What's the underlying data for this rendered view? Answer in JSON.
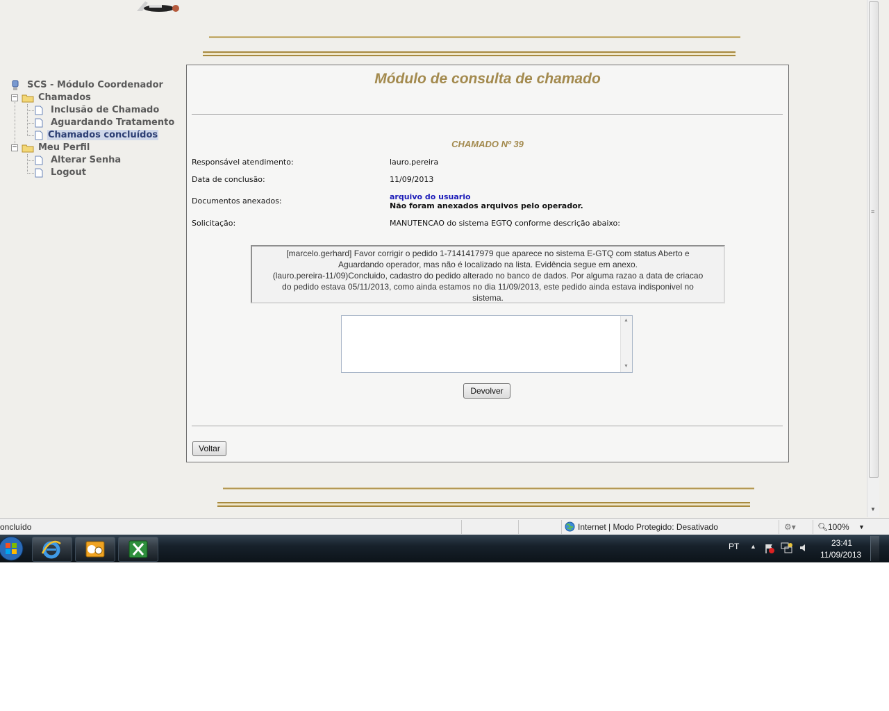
{
  "tree": {
    "root_label": "SCS - Módulo Coordenador",
    "groups": [
      {
        "label": "Chamados",
        "items": [
          "Inclusão de Chamado",
          "Aguardando Tratamento",
          "Chamados concluídos"
        ]
      },
      {
        "label": "Meu Perfil",
        "items": [
          "Alterar Senha",
          "Logout"
        ]
      }
    ],
    "selected": "Chamados concluídos"
  },
  "panel": {
    "title": "Módulo de consulta de chamado",
    "chamado": "CHAMADO Nº 39",
    "fields": [
      {
        "label": "Responsável atendimento:",
        "value": "lauro.pereira"
      },
      {
        "label": "Data de conclusão:",
        "value": "11/09/2013"
      },
      {
        "label": "Documentos anexados:",
        "link": "arquivo do usuario",
        "value": "Não foram anexados arquivos pelo operador."
      },
      {
        "label": "Solicitação:",
        "value": "MANUTENCAO do sistema EGTQ conforme descrição abaixo:"
      }
    ],
    "description_lines": [
      "[marcelo.gerhard] Favor corrigir o pedido 1-7141417979 que aparece no sistema E-GTQ com status Aberto e",
      "Aguardando operador, mas não é localizado na lista. Evidência segue em anexo.",
      "(lauro.pereira-11/09)Concluido, cadastro do pedido alterado no banco de dados. Por alguma razao a data de criacao",
      "do pedido estava 05/11/2013, como ainda estamos no dia 11/09/2013, este pedido ainda estava indisponivel no",
      "sistema."
    ],
    "reply_value": "",
    "devolver_label": "Devolver",
    "voltar_label": "Voltar"
  },
  "statusbar": {
    "left": "oncluído",
    "zone": "Internet | Modo Protegido: Desativado",
    "zoom": "100%"
  },
  "taskbar": {
    "lang": "PT",
    "time": "23:41",
    "date": "11/09/2013",
    "apps": [
      "internet-explorer-icon",
      "outlook-icon",
      "excel-icon"
    ]
  },
  "colors": {
    "title_gold": "#a38a4e",
    "link_blue": "#1b1bb8",
    "selection": "#cfd8ea"
  }
}
